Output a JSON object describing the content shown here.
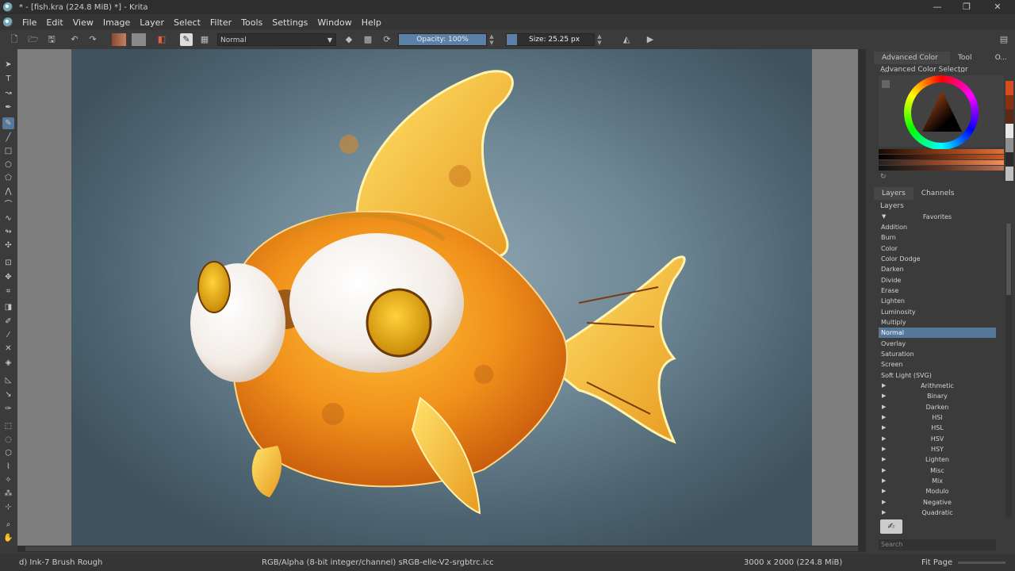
{
  "window": {
    "title": "* - [fish.kra (224.8 MiB) *] - Krita",
    "controls": {
      "minimize": "—",
      "restore": "❐",
      "close": "✕"
    }
  },
  "menu": [
    "File",
    "Edit",
    "View",
    "Image",
    "Layer",
    "Select",
    "Filter",
    "Tools",
    "Settings",
    "Window",
    "Help"
  ],
  "toolbar": {
    "blend_mode": "Normal",
    "opacity_label": "Opacity: 100%",
    "opacity_value": 100,
    "size_label": "Size: 25.25 px",
    "size_fill_fraction": 0.12
  },
  "docker": {
    "top_tabs": [
      "Advanced Color ...",
      "Tool ...",
      "O..."
    ],
    "color_selector_title": "Advanced Color Selector",
    "layer_tabs": [
      "Layers",
      "Channels"
    ],
    "layers_title": "Layers",
    "favorites_label": "Favorites",
    "blend_modes": [
      "Addition",
      "Burn",
      "Color",
      "Color Dodge",
      "Darken",
      "Divide",
      "Erase",
      "Lighten",
      "Luminosity",
      "Multiply",
      "Normal",
      "Overlay",
      "Saturation",
      "Screen",
      "Soft Light (SVG)"
    ],
    "selected_mode": "Normal",
    "categories": [
      "Arithmetic",
      "Binary",
      "Darken",
      "HSI",
      "HSL",
      "HSV",
      "HSY",
      "Lighten",
      "Misc",
      "Mix",
      "Modulo",
      "Negative",
      "Quadratic"
    ],
    "search_placeholder": "Search"
  },
  "status": {
    "brush": "d) Ink-7 Brush Rough",
    "color_space": "RGB/Alpha (8-bit integer/channel)  sRGB-elle-V2-srgbtrc.icc",
    "image_size": "3000 x 2000 (224.8 MiB)",
    "zoom": "Fit Page"
  },
  "colors": {
    "accent": "#56789a",
    "slider_fill": "#5b7fa6"
  }
}
